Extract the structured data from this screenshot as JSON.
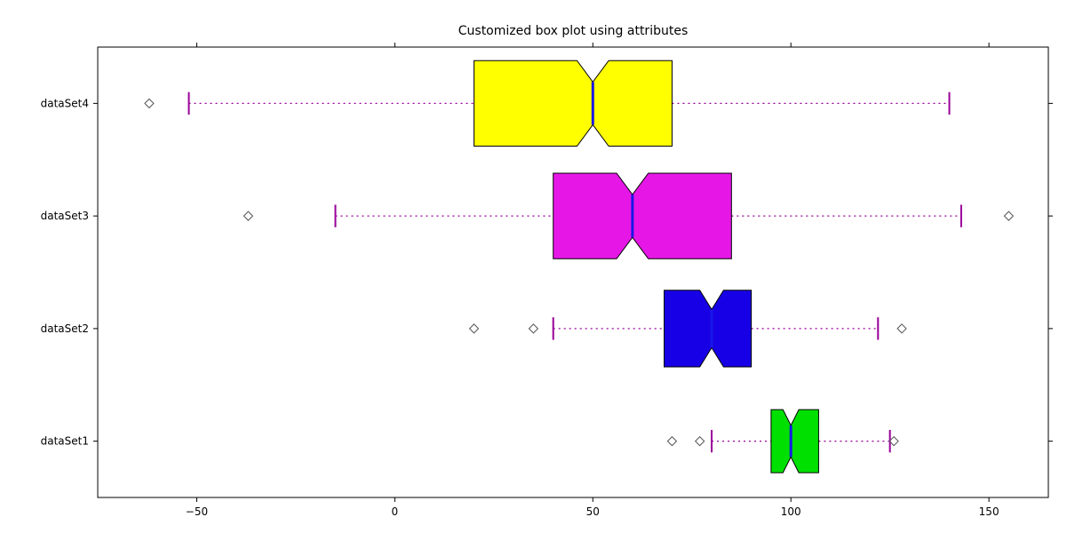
{
  "chart_data": {
    "type": "boxplot",
    "orientation": "horizontal",
    "title": "Customized box plot using attributes",
    "x_axis": {
      "min": -75,
      "max": 165,
      "ticks": [
        -50,
        0,
        50,
        100,
        150
      ]
    },
    "categories": [
      "dataSet1",
      "dataSet2",
      "dataSet3",
      "dataSet4"
    ],
    "series": [
      {
        "name": "dataSet1",
        "color": "#00E000",
        "q1": 95,
        "median": 100,
        "q3": 107,
        "whisker_low": 80,
        "whisker_high": 125,
        "outliers": [
          70,
          77,
          126
        ],
        "notch_low": 98,
        "notch_high": 102,
        "box_half_height": 0.14
      },
      {
        "name": "dataSet2",
        "color": "#1800E6",
        "q1": 68,
        "median": 80,
        "q3": 90,
        "whisker_low": 40,
        "whisker_high": 122,
        "outliers": [
          20,
          35,
          128
        ],
        "notch_low": 77,
        "notch_high": 83,
        "box_half_height": 0.17
      },
      {
        "name": "dataSet3",
        "color": "#E617E6",
        "q1": 40,
        "median": 60,
        "q3": 85,
        "whisker_low": -15,
        "whisker_high": 143,
        "outliers": [
          -37,
          155
        ],
        "notch_low": 56,
        "notch_high": 64,
        "box_half_height": 0.19
      },
      {
        "name": "dataSet4",
        "color": "#FFFF00",
        "q1": 20,
        "median": 50,
        "q3": 70,
        "whisker_low": -52,
        "whisker_high": 140,
        "outliers": [
          -62
        ],
        "notch_low": 46,
        "notch_high": 54,
        "box_half_height": 0.19
      }
    ],
    "whisker_color": "#990099",
    "cap_color": "#990099",
    "median_color": "#1818E6",
    "flier_color": "#555555"
  }
}
